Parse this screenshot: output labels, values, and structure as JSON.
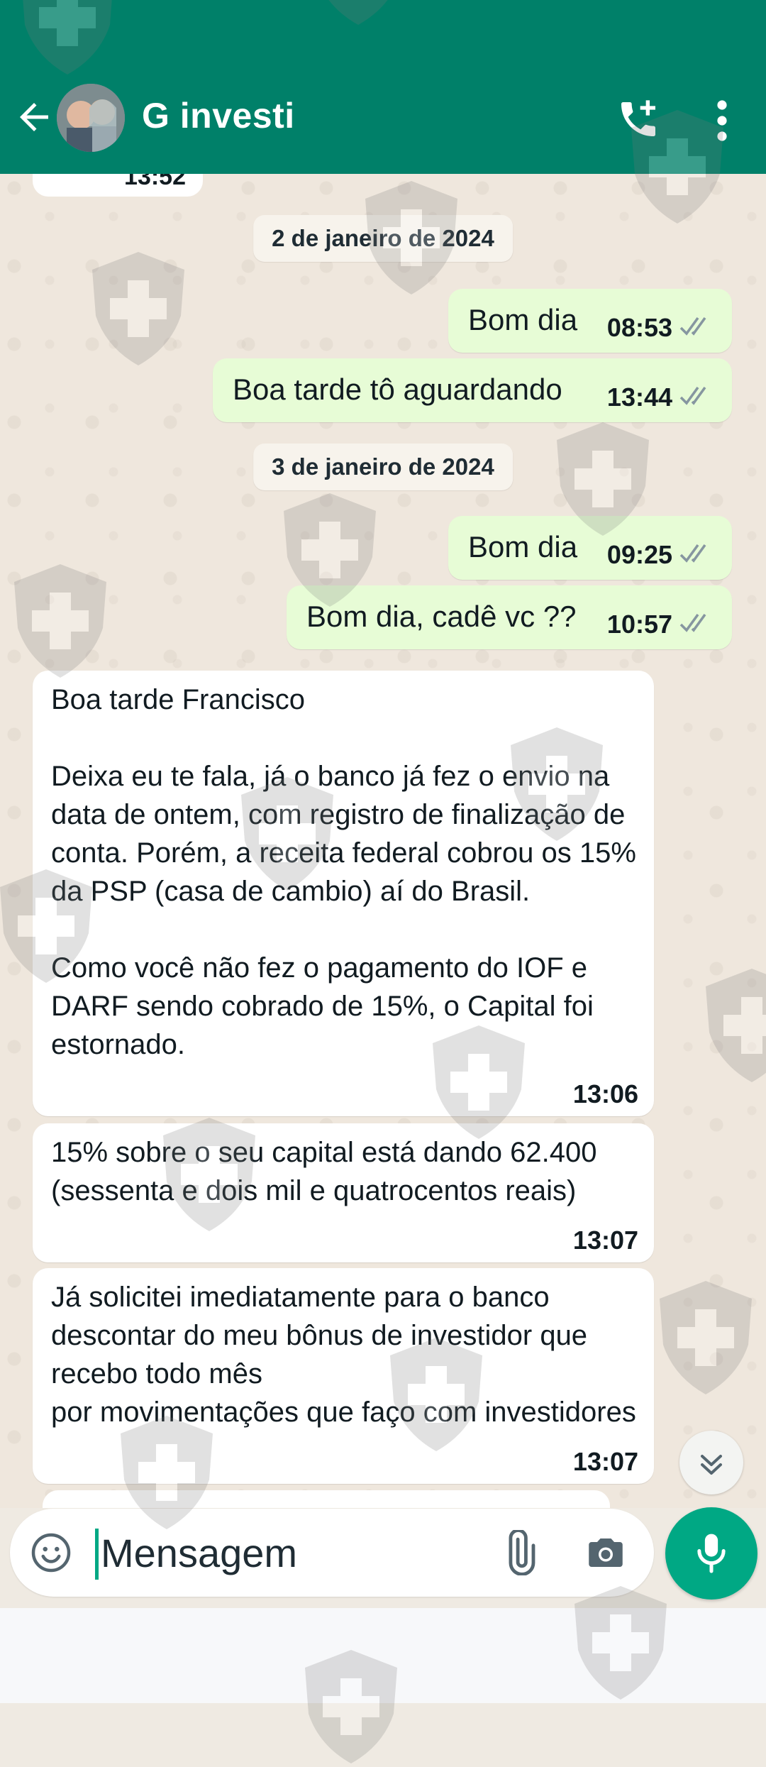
{
  "header": {
    "title": "G investi",
    "back_icon": "arrow-left-icon",
    "call_icon": "add-call-icon",
    "menu_icon": "more-vertical-icon"
  },
  "colors": {
    "header": "#008069",
    "outgoing_bubble": "#e7fcd6",
    "incoming_bubble": "#ffffff",
    "accent": "#00a884",
    "read_ticks": "#8696a0"
  },
  "chat": {
    "previous_time": "13:52",
    "dates": [
      "2 de janeiro de 2024",
      "3 de janeiro de 2024"
    ],
    "outgoing": [
      {
        "text": "Bom dia",
        "time": "08:53"
      },
      {
        "text": "Boa tarde tô aguardando",
        "time": "13:44"
      },
      {
        "text": "Bom dia",
        "time": "09:25"
      },
      {
        "text": "Bom dia, cadê vc ??",
        "time": "10:57"
      }
    ],
    "incoming": [
      {
        "text": "Boa tarde Francisco\n\nDeixa eu te fala, já o banco já fez o envio na data de ontem, com registro de finalização de conta. Porém, a receita federal cobrou os 15% da PSP (casa de cambio) aí do Brasil.\n\nComo você não fez o pagamento do IOF e DARF sendo cobrado de 15%, o Capital foi estornado.",
        "time": "13:06"
      },
      {
        "text": "15% sobre o seu capital está dando 62.400 (sessenta e dois mil e quatrocentos reais)",
        "time": "13:07"
      },
      {
        "text": "Já solicitei imediatamente para o banco descontar do meu bônus de investidor que recebo todo mês\npor movimentações que faço com investidores",
        "time": "13:07"
      }
    ]
  },
  "composer": {
    "placeholder": "Mensagem",
    "emoji_icon": "emoji-icon",
    "attach_icon": "paperclip-icon",
    "camera_icon": "camera-icon",
    "mic_icon": "microphone-icon"
  },
  "scroll_icon": "double-chevron-down-icon"
}
